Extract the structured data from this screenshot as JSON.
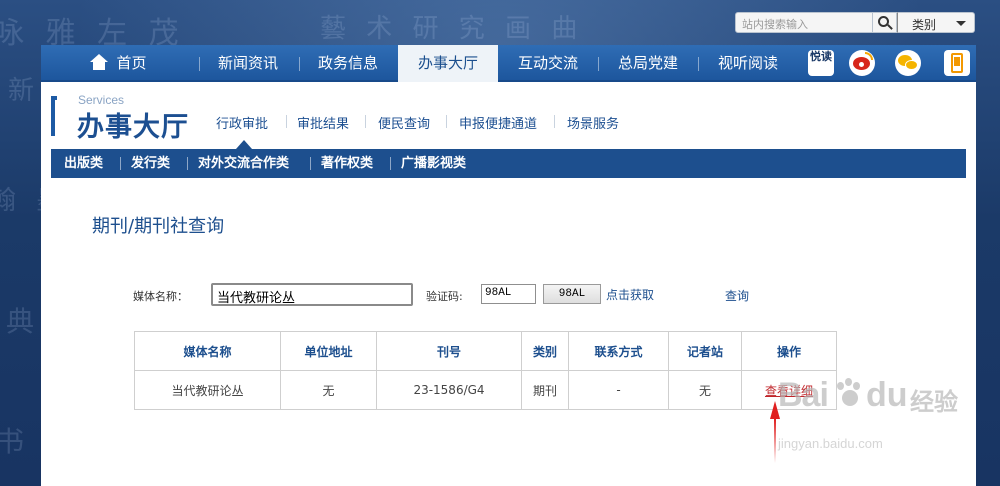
{
  "search": {
    "placeholder": "站内搜索输入",
    "category_label": "类别"
  },
  "nav": {
    "items": [
      {
        "label": "首页"
      },
      {
        "label": "新闻资讯"
      },
      {
        "label": "政务信息"
      },
      {
        "label": "办事大厅"
      },
      {
        "label": "互动交流"
      },
      {
        "label": "总局党建"
      },
      {
        "label": "视听阅读"
      }
    ],
    "active_index": 3,
    "social_icons": [
      "yuedu-icon",
      "weibo-icon",
      "wechat-icon",
      "mobile-icon"
    ],
    "yuedu_label": "悦读"
  },
  "section": {
    "title_en": "Services",
    "title_cn": "办事大厅",
    "subnav": [
      "行政审批",
      "审批结果",
      "便民查询",
      "申报便捷通道",
      "场景服务"
    ]
  },
  "categories": [
    "出版类",
    "发行类",
    "对外交流合作类",
    "著作权类",
    "广播影视类"
  ],
  "page": {
    "title": "期刊/期刊社查询"
  },
  "form": {
    "media_label": "媒体名称：",
    "media_value": "当代教研论丛",
    "code_label": "验证码:",
    "code_value": "98AL",
    "code_image_text": "98AL",
    "code_refresh_link": "点击获取",
    "query_link": "查询"
  },
  "table": {
    "headers": [
      "媒体名称",
      "单位地址",
      "刊号",
      "类别",
      "联系方式",
      "记者站",
      "操作"
    ],
    "rows": [
      [
        "当代教研论丛",
        "无",
        "23-1586/G4",
        "期刊",
        "-",
        "无",
        "查看详细"
      ]
    ]
  },
  "watermark": {
    "brand_left": "Bai",
    "brand_right": "du",
    "brand_cn": "经验",
    "url": "jingyan.baidu.com"
  },
  "colors": {
    "primary": "#1d4f8e",
    "nav": "#2460a8",
    "link_red": "#c0262b",
    "background": "#1f3f6e"
  }
}
